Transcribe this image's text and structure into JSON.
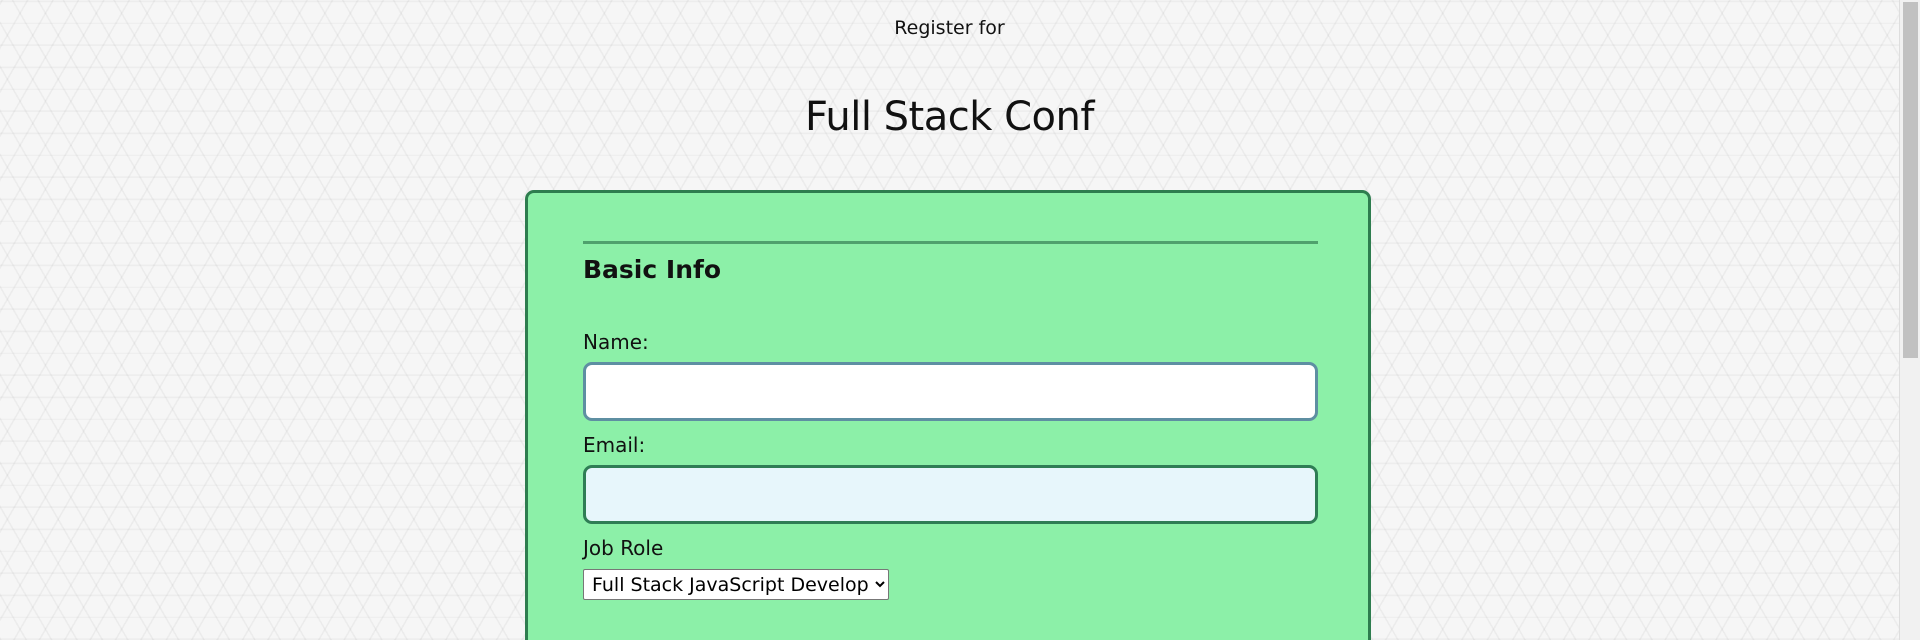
{
  "header": {
    "subtitle": "Register for",
    "title": "Full Stack Conf"
  },
  "form": {
    "section_title": "Basic Info",
    "name": {
      "label": "Name:",
      "value": ""
    },
    "email": {
      "label": "Email:",
      "value": ""
    },
    "job_role": {
      "label": "Job Role",
      "selected": "Full Stack JavaScript Developer"
    }
  },
  "colors": {
    "card_background": "#8cf0a8",
    "card_border": "#2e7d4f",
    "name_input_border": "#5e8fa2",
    "email_input_background": "#e7f6fb",
    "email_input_border": "#2f7d55"
  }
}
